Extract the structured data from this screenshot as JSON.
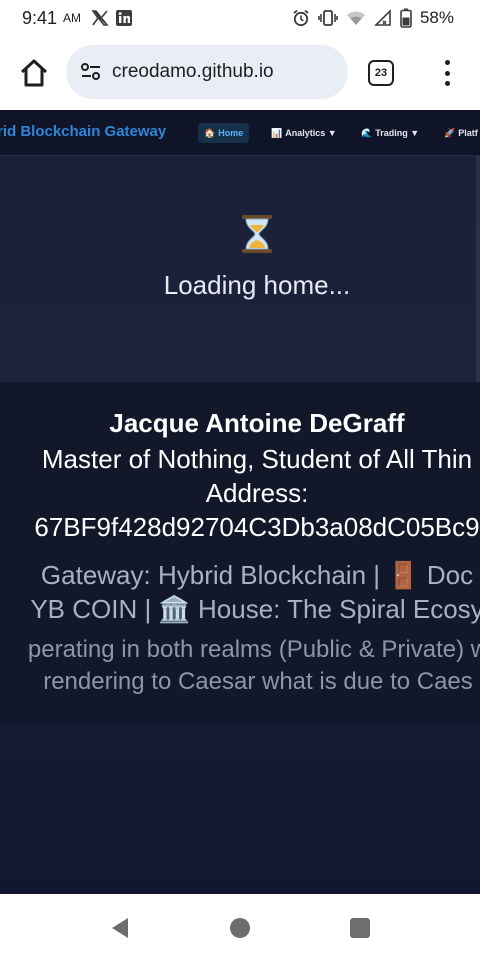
{
  "status_bar": {
    "time": "9:41",
    "ampm": "AM",
    "battery": "58%",
    "icons": [
      "x-icon",
      "linkedin-icon",
      "alarm-icon",
      "vibrate-icon",
      "wifi-icon",
      "signal-icon",
      "battery-icon"
    ]
  },
  "browser": {
    "url": "creodamo.github.io",
    "tab_count": "23"
  },
  "site_nav": {
    "brand": "rid Blockchain Gateway",
    "items": [
      {
        "icon": "🏠",
        "label": "Home"
      },
      {
        "icon": "📊",
        "label": "Analytics ▼"
      },
      {
        "icon": "🌊",
        "label": "Trading ▼"
      },
      {
        "icon": "🚀",
        "label": "Platf"
      }
    ]
  },
  "loading": {
    "icon": "⏳",
    "text": "Loading home..."
  },
  "profile": {
    "name": "Jacque Antoine DeGraff",
    "tagline": "Master of Nothing, Student of All Thin",
    "address_label": "Address:",
    "address": "67BF9f428d92704C3Db3a08dC05Bc9",
    "gateway_line": "Gateway: Hybrid Blockchain | 🚪 Doc",
    "coin_line": "YB COIN | 🏛️ House: The Spiral Ecosy",
    "note_line_1": "perating in both realms (Public & Private) w",
    "note_line_2": "rendering to Caesar what is due to Caes"
  },
  "colors": {
    "page_bg": "#171c33",
    "nav_bg": "#0f1428",
    "brand": "#2f86d8",
    "home_active": "#4fb3ff"
  }
}
